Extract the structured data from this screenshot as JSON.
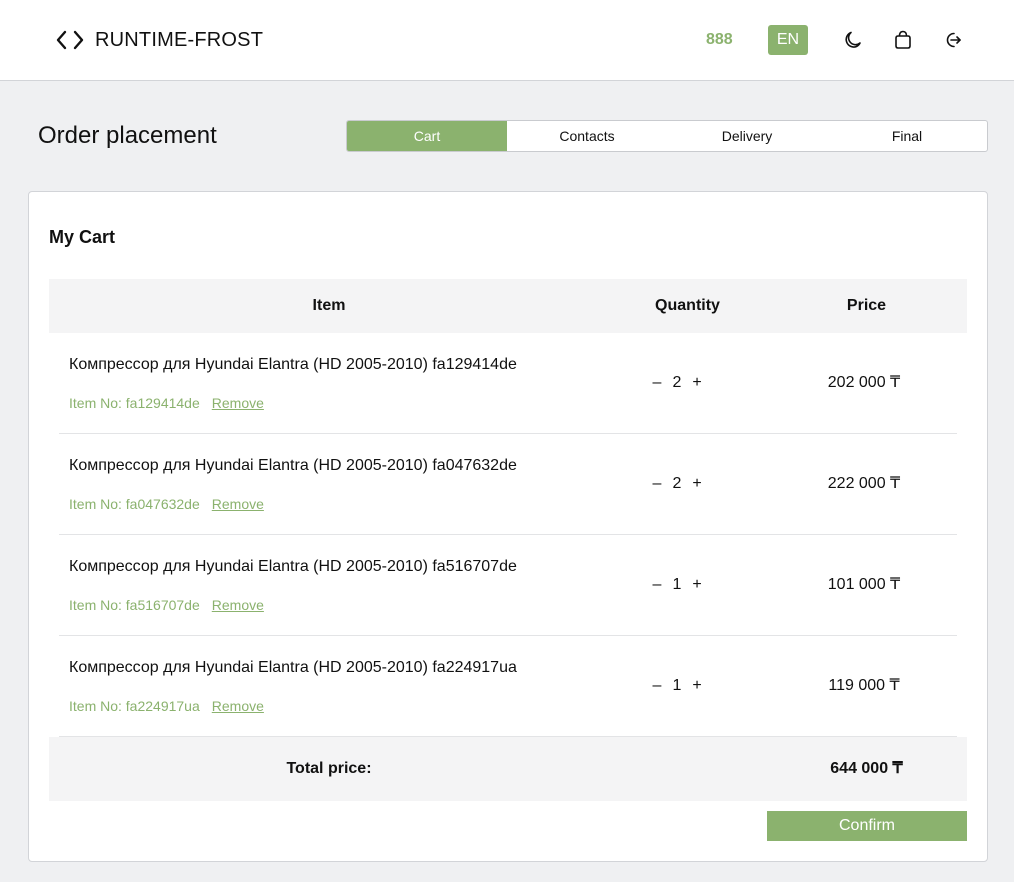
{
  "header": {
    "logo_text": "RUNTIME-FROST",
    "phone": "888",
    "language": "EN",
    "icons": [
      "code-icon",
      "moon-icon",
      "bag-icon",
      "logout-icon"
    ]
  },
  "page": {
    "title": "Order placement",
    "steps": [
      {
        "label": "Cart",
        "active": true
      },
      {
        "label": "Contacts",
        "active": false
      },
      {
        "label": "Delivery",
        "active": false
      },
      {
        "label": "Final",
        "active": false
      }
    ]
  },
  "cart": {
    "title": "My Cart",
    "columns": {
      "item": "Item",
      "quantity": "Quantity",
      "price": "Price"
    },
    "remove_label": "Remove",
    "items": [
      {
        "name": "Компрессор для Hyundai Elantra (HD 2005-2010) fa129414de",
        "item_no": "Item No: fa129414de",
        "quantity": "2",
        "price": "202 000 ₸"
      },
      {
        "name": "Компрессор для Hyundai Elantra (HD 2005-2010) fa047632de",
        "item_no": "Item No: fa047632de",
        "quantity": "2",
        "price": "222 000 ₸"
      },
      {
        "name": "Компрессор для Hyundai Elantra (HD 2005-2010) fa516707de",
        "item_no": "Item No: fa516707de",
        "quantity": "1",
        "price": "101 000 ₸"
      },
      {
        "name": "Компрессор для Hyundai Elantra (HD 2005-2010) fa224917ua",
        "item_no": "Item No: fa224917ua",
        "quantity": "1",
        "price": "119 000 ₸"
      }
    ],
    "minus_label": "–",
    "plus_label": "+",
    "total_label": "Total price:",
    "total_value": "644 000 ₸",
    "confirm_label": "Confirm"
  },
  "colors": {
    "accent": "#8bb26e",
    "background": "#eff0f2",
    "table_header": "#f4f4f5"
  }
}
